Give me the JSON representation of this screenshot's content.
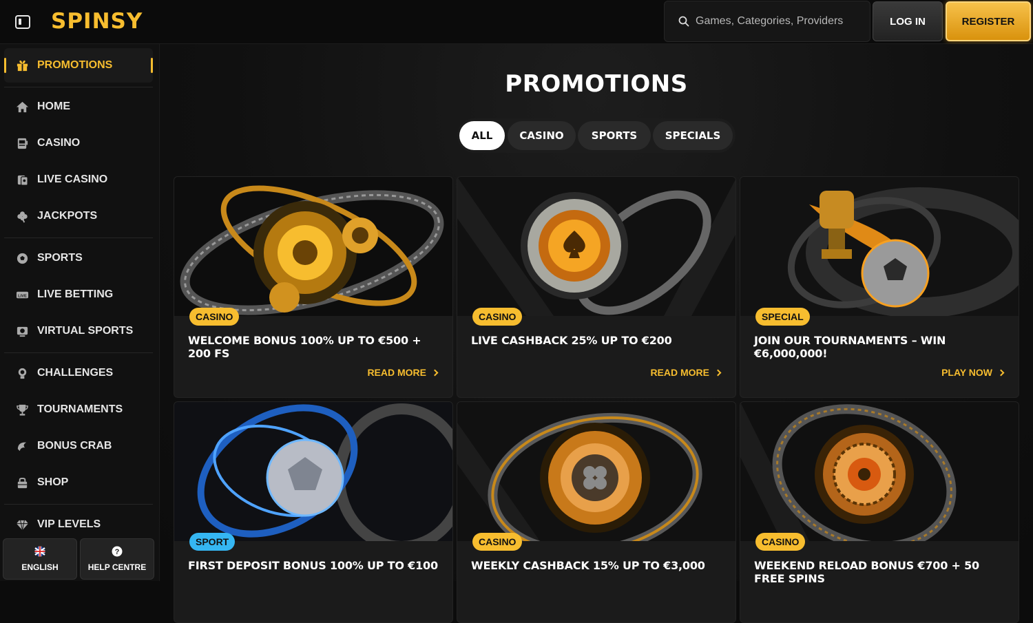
{
  "header": {
    "logo": "SPINSY",
    "search_placeholder": "Games, Categories, Providers",
    "login_label": "LOG IN",
    "register_label": "REGISTER"
  },
  "sidebar": {
    "active_item": {
      "label": "PROMOTIONS",
      "icon": "gift-icon"
    },
    "items": [
      {
        "label": "HOME",
        "icon": "home-icon"
      },
      {
        "label": "CASINO",
        "icon": "slot-machine-icon"
      },
      {
        "label": "LIVE CASINO",
        "icon": "live-cards-icon"
      },
      {
        "label": "JACKPOTS",
        "icon": "clover-icon"
      },
      {
        "label": "SPORTS",
        "icon": "soccer-ball-icon"
      },
      {
        "label": "LIVE BETTING",
        "icon": "live-tag-icon"
      },
      {
        "label": "VIRTUAL SPORTS",
        "icon": "virtual-monitor-icon"
      },
      {
        "label": "CHALLENGES",
        "icon": "challenge-icon"
      },
      {
        "label": "TOURNAMENTS",
        "icon": "trophy-icon"
      },
      {
        "label": "BONUS CRAB",
        "icon": "crab-icon"
      },
      {
        "label": "SHOP",
        "icon": "shop-bag-icon"
      },
      {
        "label": "VIP LEVELS",
        "icon": "diamond-icon"
      }
    ],
    "footer": {
      "language_label": "ENGLISH",
      "language_icon": "uk-flag-icon",
      "help_label": "HELP CENTRE",
      "help_icon": "question-icon"
    }
  },
  "main": {
    "title": "PROMOTIONS",
    "tabs": [
      {
        "label": "ALL",
        "active": true
      },
      {
        "label": "CASINO",
        "active": false
      },
      {
        "label": "SPORTS",
        "active": false
      },
      {
        "label": "SPECIALS",
        "active": false
      }
    ],
    "promotions": [
      {
        "badge": "CASINO",
        "badge_color": "#f7bd2f",
        "title": "WELCOME BONUS 100% UP TO €500 + 200 FS",
        "cta": "READ MORE"
      },
      {
        "badge": "CASINO",
        "badge_color": "#f7bd2f",
        "title": "LIVE CASHBACK 25% UP TO €200",
        "cta": "READ MORE"
      },
      {
        "badge": "SPECIAL",
        "badge_color": "#f7bd2f",
        "title": "JOIN OUR TOURNAMENTS – WIN €6,000,000!",
        "cta": "PLAY NOW"
      },
      {
        "badge": "SPORT",
        "badge_color": "#35b6f2",
        "title": "FIRST DEPOSIT BONUS 100% UP TO €100",
        "cta": ""
      },
      {
        "badge": "CASINO",
        "badge_color": "#f7bd2f",
        "title": "WEEKLY CASHBACK 15% UP TO €3,000",
        "cta": ""
      },
      {
        "badge": "CASINO",
        "badge_color": "#f7bd2f",
        "title": "WEEKEND RELOAD BONUS €700 + 50 FREE SPINS",
        "cta": ""
      }
    ]
  },
  "colors": {
    "accent": "#f7bd2f",
    "sport_badge": "#35b6f2",
    "background": "#0c0c0c"
  }
}
